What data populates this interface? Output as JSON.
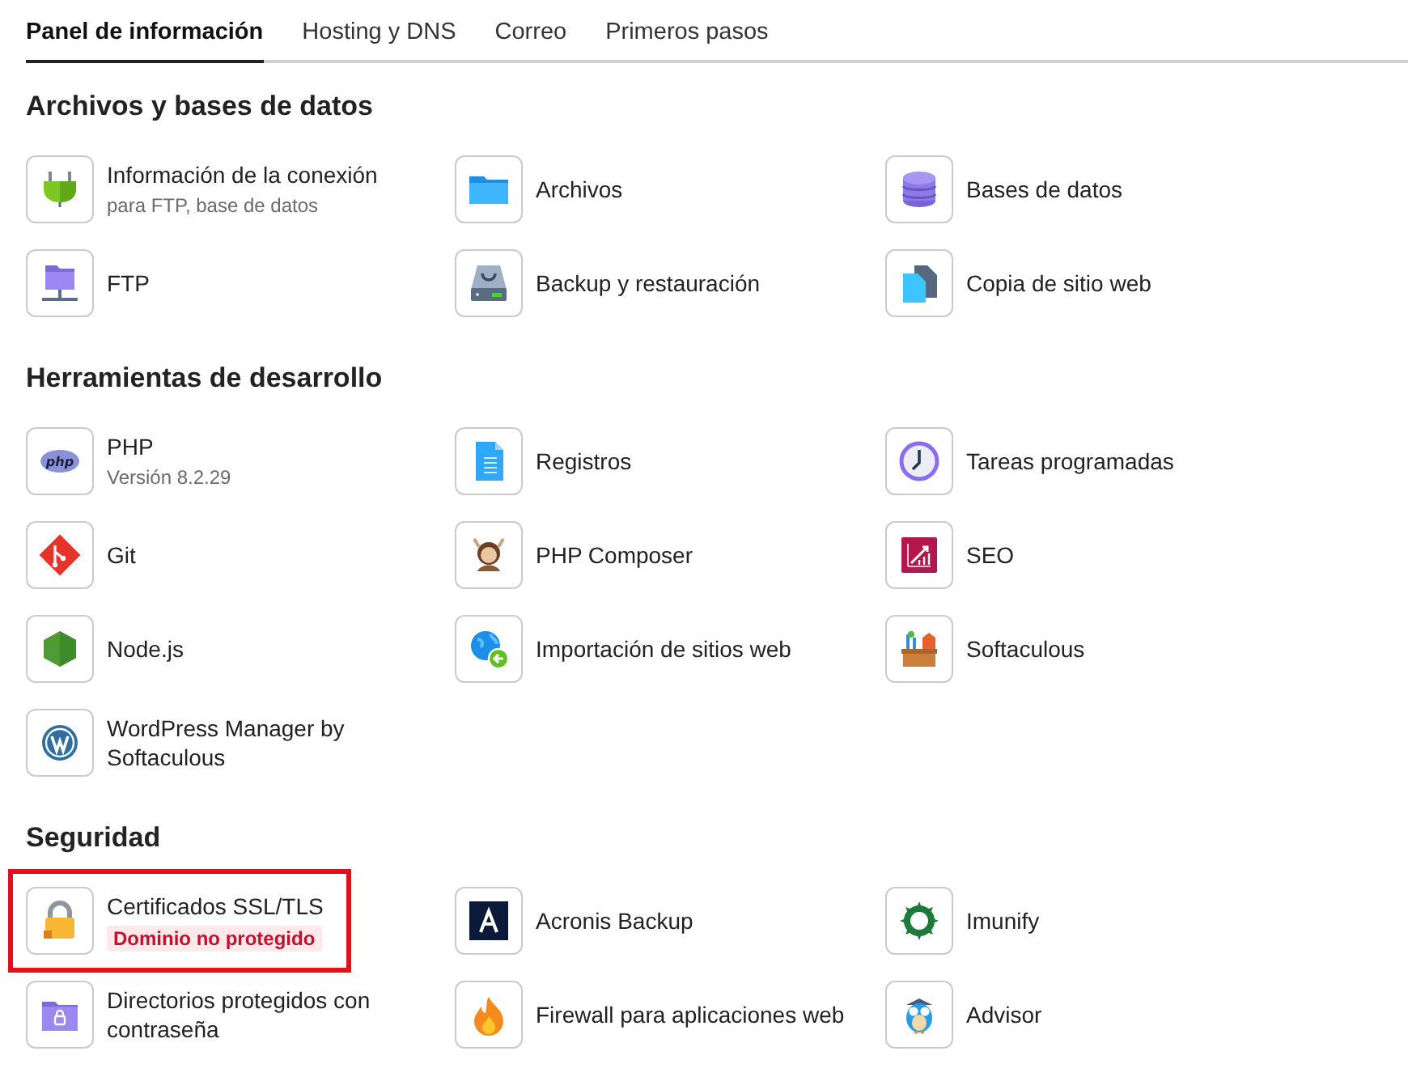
{
  "tabs": [
    {
      "label": "Panel de información",
      "selected": true
    },
    {
      "label": "Hosting y DNS",
      "selected": false
    },
    {
      "label": "Correo",
      "selected": false
    },
    {
      "label": "Primeros pasos",
      "selected": false
    }
  ],
  "sections": [
    {
      "title": "Archivos y bases de datos",
      "items": [
        {
          "title": "Información de la conexión",
          "subtitle": "para FTP, base de datos"
        },
        {
          "title": "Archivos"
        },
        {
          "title": "Bases de datos"
        },
        {
          "title": "FTP"
        },
        {
          "title": "Backup y restauración"
        },
        {
          "title": "Copia de sitio web"
        }
      ]
    },
    {
      "title": "Herramientas de desarrollo",
      "items": [
        {
          "title": "PHP",
          "subtitle": "Versión 8.2.29",
          "logo_text": "php"
        },
        {
          "title": "Registros"
        },
        {
          "title": "Tareas programadas"
        },
        {
          "title": "Git"
        },
        {
          "title": "PHP Composer"
        },
        {
          "title": "SEO"
        },
        {
          "title": "Node.js"
        },
        {
          "title": "Importación de sitios web"
        },
        {
          "title": "Softaculous"
        },
        {
          "title": "WordPress Manager by Softaculous"
        }
      ]
    },
    {
      "title": "Seguridad",
      "items": [
        {
          "title": "Certificados SSL/TLS",
          "badge": "Dominio no protegido",
          "highlighted": true
        },
        {
          "title": "Acronis Backup"
        },
        {
          "title": "Imunify"
        },
        {
          "title": "Directorios protegidos con contraseña"
        },
        {
          "title": "Firewall para aplicaciones web"
        },
        {
          "title": "Advisor"
        }
      ]
    }
  ]
}
